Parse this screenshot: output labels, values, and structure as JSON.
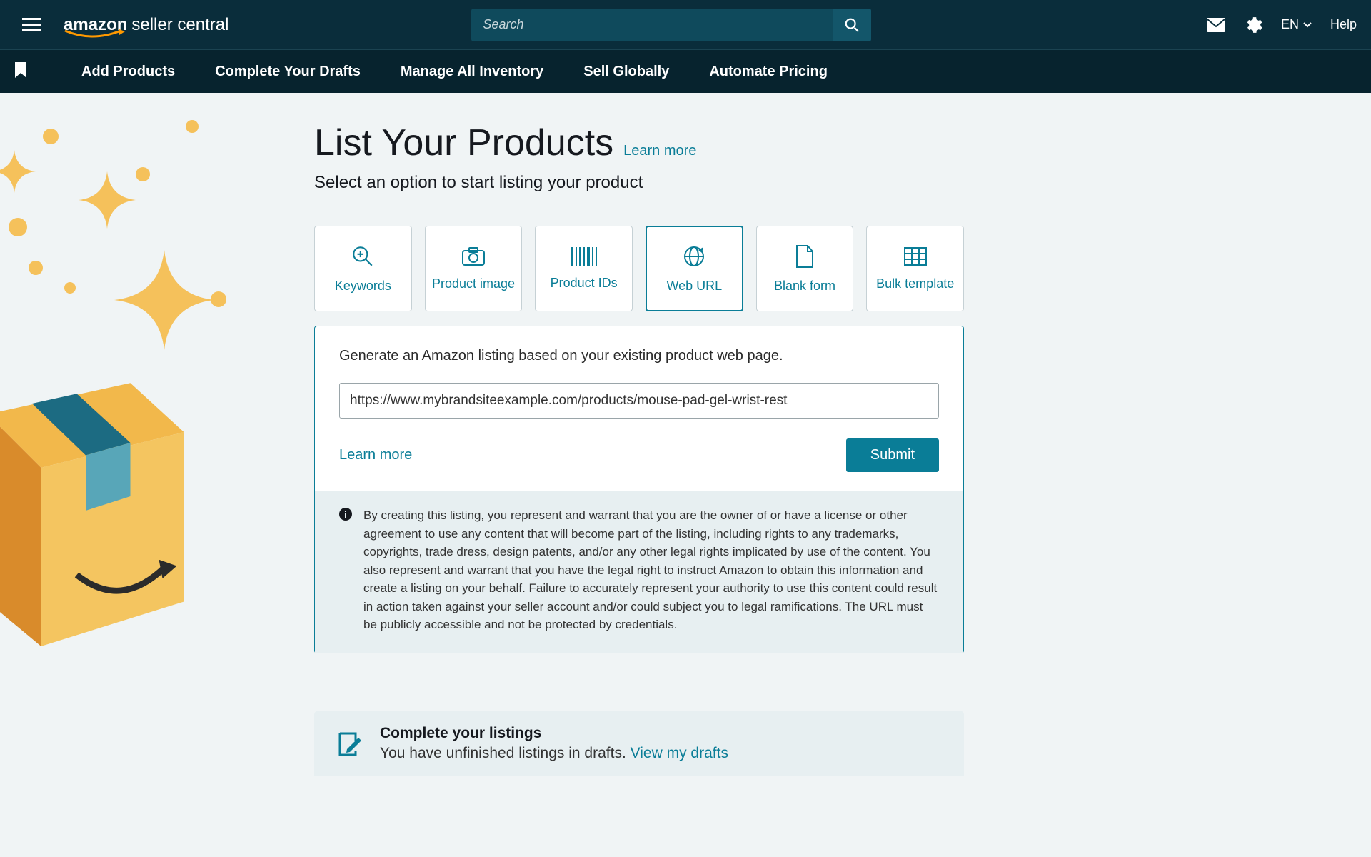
{
  "header": {
    "logo_brand": "amazon",
    "logo_suffix": "seller central",
    "search_placeholder": "Search",
    "language": "EN",
    "help": "Help"
  },
  "nav": {
    "items": [
      "Add Products",
      "Complete Your Drafts",
      "Manage All Inventory",
      "Sell Globally",
      "Automate Pricing"
    ]
  },
  "page": {
    "title": "List Your Products",
    "learn_more": "Learn more",
    "subtitle": "Select an option to start listing your product",
    "options": [
      {
        "label": "Keywords",
        "icon": "search-zoom"
      },
      {
        "label": "Product image",
        "icon": "camera"
      },
      {
        "label": "Product IDs",
        "icon": "barcode"
      },
      {
        "label": "Web URL",
        "icon": "globe-arrow"
      },
      {
        "label": "Blank form",
        "icon": "file"
      },
      {
        "label": "Bulk template",
        "icon": "grid"
      }
    ],
    "active_option_index": 3
  },
  "panel": {
    "description": "Generate an Amazon listing based on your existing product web page.",
    "url_value": "https://www.mybrandsiteexample.com/products/mouse-pad-gel-wrist-rest",
    "learn_more": "Learn more",
    "submit": "Submit",
    "disclaimer": "By creating this listing, you represent and warrant that you are the owner of or have a license or other agreement to use any content that will become part of the listing, including rights to any trademarks, copyrights, trade dress, design patents, and/or any other legal rights implicated by use of the content. You also represent and warrant that you have the legal right to instruct Amazon to obtain this information and create a listing on your behalf. Failure to accurately represent your authority to use this content could result in action taken against your seller account and/or could subject you to legal ramifications. The URL must be publicly accessible and not be protected by credentials."
  },
  "complete_bar": {
    "title": "Complete your listings",
    "subtitle": "You have unfinished listings in drafts.",
    "link": "View my drafts"
  }
}
